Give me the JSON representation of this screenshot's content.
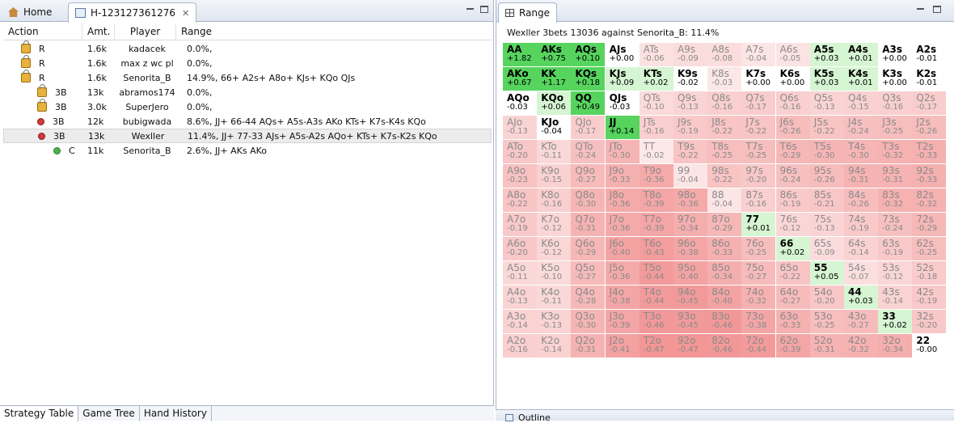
{
  "tabs": {
    "home": "Home",
    "hand": "H-123127361276",
    "range": "Range",
    "outline": "Outline"
  },
  "table": {
    "headers": [
      "Action",
      "Amt.",
      "Player",
      "Range"
    ],
    "rows": [
      {
        "icon": "lock",
        "indent": 0,
        "action": "R",
        "amt": "1.6k",
        "player": "kadacek",
        "range": "0.0%,"
      },
      {
        "icon": "lock",
        "indent": 0,
        "action": "R",
        "amt": "1.6k",
        "player": "max z wc pl",
        "range": "0.0%,"
      },
      {
        "icon": "lock",
        "indent": 0,
        "action": "R",
        "amt": "1.6k",
        "player": "Senorita_B",
        "range": "14.9%, 66+ A2s+ A8o+ KJs+ KQo QJs"
      },
      {
        "icon": "lock",
        "indent": 1,
        "action": "3B",
        "amt": "13k",
        "player": "abramos174",
        "range": "0.0%,"
      },
      {
        "icon": "lock",
        "indent": 1,
        "action": "3B",
        "amt": "3.0k",
        "player": "SuperJero",
        "range": "0.0%,"
      },
      {
        "icon": "red",
        "indent": 1,
        "action": "3B",
        "amt": "12k",
        "player": "bubigwada",
        "range": "8.6%, JJ+ 66-44 AQs+ A5s-A3s AKo KTs+ K7s-K4s KQo"
      },
      {
        "icon": "red",
        "indent": 1,
        "action": "3B",
        "amt": "13k",
        "player": "Wexller",
        "range": "11.4%, JJ+ 77-33 AJs+ A5s-A2s AQo+ KTs+ K7s-K2s KQo"
      },
      {
        "icon": "green",
        "indent": 2,
        "action": "C",
        "amt": "11k",
        "player": "Senorita_B",
        "range": "2.6%, JJ+ AKs AKo"
      }
    ]
  },
  "bottom_tabs": [
    "Strategy Table",
    "Game Tree",
    "Hand History"
  ],
  "range_panel": {
    "title": "Wexller 3bets 13036 against Senorita_B: 11.4%",
    "colors": {
      "green_strong": "#56d45e",
      "green_light": "#d6f5d3",
      "white": "#ffffff",
      "red_light": "#fbe3e3",
      "red_strong": "#f29a9a"
    },
    "grid": [
      [
        [
          "AA",
          "+1.82",
          1
        ],
        [
          "AKs",
          "+0.75",
          1
        ],
        [
          "AQs",
          "+0.10",
          1
        ],
        [
          "AJs",
          "+0.00",
          1
        ],
        [
          "ATs",
          "-0.06",
          0
        ],
        [
          "A9s",
          "-0.09",
          0
        ],
        [
          "A8s",
          "-0.08",
          0
        ],
        [
          "A7s",
          "-0.04",
          0
        ],
        [
          "A6s",
          "-0.05",
          0
        ],
        [
          "A5s",
          "+0.03",
          1
        ],
        [
          "A4s",
          "+0.01",
          1
        ],
        [
          "A3s",
          "+0.00",
          1
        ],
        [
          "A2s",
          "-0.01",
          1
        ]
      ],
      [
        [
          "AKo",
          "+0.67",
          1
        ],
        [
          "KK",
          "+1.17",
          1
        ],
        [
          "KQs",
          "+0.18",
          1
        ],
        [
          "KJs",
          "+0.09",
          1
        ],
        [
          "KTs",
          "+0.02",
          1
        ],
        [
          "K9s",
          "-0.02",
          1
        ],
        [
          "K8s",
          "-0.03",
          0
        ],
        [
          "K7s",
          "+0.00",
          1
        ],
        [
          "K6s",
          "+0.00",
          1
        ],
        [
          "K5s",
          "+0.03",
          1
        ],
        [
          "K4s",
          "+0.01",
          1
        ],
        [
          "K3s",
          "+0.00",
          1
        ],
        [
          "K2s",
          "-0.01",
          1
        ]
      ],
      [
        [
          "AQo",
          "-0.03",
          1
        ],
        [
          "KQo",
          "+0.06",
          1
        ],
        [
          "QQ",
          "+0.49",
          1
        ],
        [
          "QJs",
          "-0.03",
          1
        ],
        [
          "QTs",
          "-0.10",
          0
        ],
        [
          "Q9s",
          "-0.13",
          0
        ],
        [
          "Q8s",
          "-0.16",
          0
        ],
        [
          "Q7s",
          "-0.17",
          0
        ],
        [
          "Q6s",
          "-0.16",
          0
        ],
        [
          "Q5s",
          "-0.13",
          0
        ],
        [
          "Q4s",
          "-0.15",
          0
        ],
        [
          "Q3s",
          "-0.16",
          0
        ],
        [
          "Q2s",
          "-0.17",
          0
        ]
      ],
      [
        [
          "AJo",
          "-0.13",
          0
        ],
        [
          "KJo",
          "-0.04",
          1
        ],
        [
          "QJo",
          "-0.17",
          0
        ],
        [
          "JJ",
          "+0.14",
          1
        ],
        [
          "JTs",
          "-0.16",
          0
        ],
        [
          "J9s",
          "-0.19",
          0
        ],
        [
          "J8s",
          "-0.22",
          0
        ],
        [
          "J7s",
          "-0.22",
          0
        ],
        [
          "J6s",
          "-0.26",
          0
        ],
        [
          "J5s",
          "-0.22",
          0
        ],
        [
          "J4s",
          "-0.24",
          0
        ],
        [
          "J3s",
          "-0.25",
          0
        ],
        [
          "J2s",
          "-0.26",
          0
        ]
      ],
      [
        [
          "ATo",
          "-0.20",
          0
        ],
        [
          "KTo",
          "-0.11",
          0
        ],
        [
          "QTo",
          "-0.24",
          0
        ],
        [
          "JTo",
          "-0.30",
          0
        ],
        [
          "TT",
          "-0.02",
          0
        ],
        [
          "T9s",
          "-0.22",
          0
        ],
        [
          "T8s",
          "-0.25",
          0
        ],
        [
          "T7s",
          "-0.25",
          0
        ],
        [
          "T6s",
          "-0.29",
          0
        ],
        [
          "T5s",
          "-0.30",
          0
        ],
        [
          "T4s",
          "-0.30",
          0
        ],
        [
          "T3s",
          "-0.32",
          0
        ],
        [
          "T2s",
          "-0.33",
          0
        ]
      ],
      [
        [
          "A9o",
          "-0.23",
          0
        ],
        [
          "K9o",
          "-0.15",
          0
        ],
        [
          "Q9o",
          "-0.27",
          0
        ],
        [
          "J9o",
          "-0.33",
          0
        ],
        [
          "T9o",
          "-0.36",
          0
        ],
        [
          "99",
          "-0.04",
          0
        ],
        [
          "98s",
          "-0.22",
          0
        ],
        [
          "97s",
          "-0.20",
          0
        ],
        [
          "96s",
          "-0.24",
          0
        ],
        [
          "95s",
          "-0.26",
          0
        ],
        [
          "94s",
          "-0.31",
          0
        ],
        [
          "93s",
          "-0.31",
          0
        ],
        [
          "92s",
          "-0.33",
          0
        ]
      ],
      [
        [
          "A8o",
          "-0.22",
          0
        ],
        [
          "K8o",
          "-0.16",
          0
        ],
        [
          "Q8o",
          "-0.30",
          0
        ],
        [
          "J8o",
          "-0.36",
          0
        ],
        [
          "T8o",
          "-0.39",
          0
        ],
        [
          "98o",
          "-0.36",
          0
        ],
        [
          "88",
          "-0.04",
          0
        ],
        [
          "87s",
          "-0.16",
          0
        ],
        [
          "86s",
          "-0.19",
          0
        ],
        [
          "85s",
          "-0.21",
          0
        ],
        [
          "84s",
          "-0.26",
          0
        ],
        [
          "83s",
          "-0.32",
          0
        ],
        [
          "82s",
          "-0.32",
          0
        ]
      ],
      [
        [
          "A7o",
          "-0.19",
          0
        ],
        [
          "K7o",
          "-0.12",
          0
        ],
        [
          "Q7o",
          "-0.31",
          0
        ],
        [
          "J7o",
          "-0.36",
          0
        ],
        [
          "T7o",
          "-0.39",
          0
        ],
        [
          "97o",
          "-0.34",
          0
        ],
        [
          "87o",
          "-0.29",
          0
        ],
        [
          "77",
          "+0.01",
          1
        ],
        [
          "76s",
          "-0.12",
          0
        ],
        [
          "75s",
          "-0.13",
          0
        ],
        [
          "74s",
          "-0.19",
          0
        ],
        [
          "73s",
          "-0.24",
          0
        ],
        [
          "72s",
          "-0.29",
          0
        ]
      ],
      [
        [
          "A6o",
          "-0.20",
          0
        ],
        [
          "K6o",
          "-0.12",
          0
        ],
        [
          "Q6o",
          "-0.29",
          0
        ],
        [
          "J6o",
          "-0.40",
          0
        ],
        [
          "T6o",
          "-0.43",
          0
        ],
        [
          "96o",
          "-0.38",
          0
        ],
        [
          "86o",
          "-0.33",
          0
        ],
        [
          "76o",
          "-0.25",
          0
        ],
        [
          "66",
          "+0.02",
          1
        ],
        [
          "65s",
          "-0.09",
          0
        ],
        [
          "64s",
          "-0.14",
          0
        ],
        [
          "63s",
          "-0.19",
          0
        ],
        [
          "62s",
          "-0.25",
          0
        ]
      ],
      [
        [
          "A5o",
          "-0.11",
          0
        ],
        [
          "K5o",
          "-0.10",
          0
        ],
        [
          "Q5o",
          "-0.27",
          0
        ],
        [
          "J5o",
          "-0.36",
          0
        ],
        [
          "T5o",
          "-0.44",
          0
        ],
        [
          "95o",
          "-0.40",
          0
        ],
        [
          "85o",
          "-0.34",
          0
        ],
        [
          "75o",
          "-0.27",
          0
        ],
        [
          "65o",
          "-0.22",
          0
        ],
        [
          "55",
          "+0.05",
          1
        ],
        [
          "54s",
          "-0.07",
          0
        ],
        [
          "53s",
          "-0.12",
          0
        ],
        [
          "52s",
          "-0.18",
          0
        ]
      ],
      [
        [
          "A4o",
          "-0.13",
          0
        ],
        [
          "K4o",
          "-0.11",
          0
        ],
        [
          "Q4o",
          "-0.28",
          0
        ],
        [
          "J4o",
          "-0.38",
          0
        ],
        [
          "T4o",
          "-0.44",
          0
        ],
        [
          "94o",
          "-0.45",
          0
        ],
        [
          "84o",
          "-0.40",
          0
        ],
        [
          "74o",
          "-0.32",
          0
        ],
        [
          "64o",
          "-0.27",
          0
        ],
        [
          "54o",
          "-0.20",
          0
        ],
        [
          "44",
          "+0.03",
          1
        ],
        [
          "43s",
          "-0.14",
          0
        ],
        [
          "42s",
          "-0.19",
          0
        ]
      ],
      [
        [
          "A3o",
          "-0.14",
          0
        ],
        [
          "K3o",
          "-0.13",
          0
        ],
        [
          "Q3o",
          "-0.30",
          0
        ],
        [
          "J3o",
          "-0.39",
          0
        ],
        [
          "T3o",
          "-0.46",
          0
        ],
        [
          "93o",
          "-0.45",
          0
        ],
        [
          "83o",
          "-0.46",
          0
        ],
        [
          "73o",
          "-0.38",
          0
        ],
        [
          "63o",
          "-0.33",
          0
        ],
        [
          "53o",
          "-0.25",
          0
        ],
        [
          "43o",
          "-0.27",
          0
        ],
        [
          "33",
          "+0.02",
          1
        ],
        [
          "32s",
          "-0.20",
          0
        ]
      ],
      [
        [
          "A2o",
          "-0.16",
          0
        ],
        [
          "K2o",
          "-0.14",
          0
        ],
        [
          "Q2o",
          "-0.31",
          0
        ],
        [
          "J2o",
          "-0.41",
          0
        ],
        [
          "T2o",
          "-0.47",
          0
        ],
        [
          "92o",
          "-0.47",
          0
        ],
        [
          "82o",
          "-0.46",
          0
        ],
        [
          "72o",
          "-0.44",
          0
        ],
        [
          "62o",
          "-0.39",
          0
        ],
        [
          "52o",
          "-0.31",
          0
        ],
        [
          "42o",
          "-0.32",
          0
        ],
        [
          "32o",
          "-0.34",
          0
        ],
        [
          "22",
          "-0.00",
          1
        ]
      ]
    ]
  }
}
